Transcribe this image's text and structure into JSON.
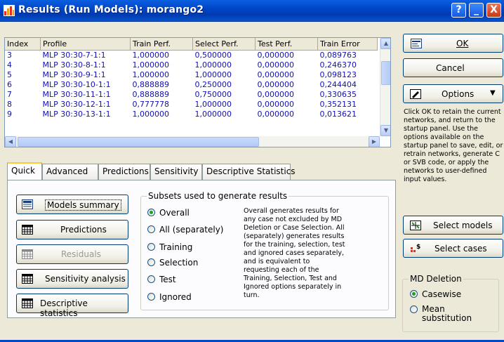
{
  "window": {
    "title": "Results (Run Models): morango2",
    "help_label": "?",
    "min_label": "_",
    "close_label": "X"
  },
  "table": {
    "columns": [
      "Index",
      "Profile",
      "Train Perf.",
      "Select Perf.",
      "Test Perf.",
      "Train Error"
    ],
    "rows": [
      [
        "3",
        "MLP 30:30-7-1:1",
        "1,000000",
        "0,500000",
        "0,000000",
        "0,089763"
      ],
      [
        "4",
        "MLP 30:30-8-1:1",
        "1,000000",
        "1,000000",
        "0,000000",
        "0,246370"
      ],
      [
        "5",
        "MLP 30:30-9-1:1",
        "1,000000",
        "1,000000",
        "0,000000",
        "0,098123"
      ],
      [
        "6",
        "MLP 30:30-10-1:1",
        "0,888889",
        "0,250000",
        "0,000000",
        "0,244404"
      ],
      [
        "7",
        "MLP 30:30-11-1:1",
        "0,888889",
        "0,750000",
        "0,000000",
        "0,330635"
      ],
      [
        "8",
        "MLP 30:30-12-1:1",
        "0,777778",
        "1,000000",
        "0,000000",
        "0,352131"
      ],
      [
        "9",
        "MLP 30:30-13-1:1",
        "1,000000",
        "1,000000",
        "0,000000",
        "0,013621"
      ]
    ]
  },
  "buttons": {
    "ok": "OK",
    "cancel": "Cancel",
    "options": "Options",
    "select_models": "Select models",
    "select_cases": "Select cases"
  },
  "help_text": "Click OK to retain the current networks, and return to the startup panel. Use the options available on the startup panel to save, edit, or retrain networks, generate C or SVB code, or apply the networks to user-defined input values.",
  "md_deletion": {
    "title": "MD Deletion",
    "casewise": "Casewise",
    "mean": "Mean substitution",
    "selected": "casewise"
  },
  "tabs": [
    "Quick",
    "Advanced",
    "Predictions",
    "Sensitivity",
    "Descriptive Statistics"
  ],
  "active_tab": "Quick",
  "quick": {
    "buttons": [
      "Models summary",
      "Predictions",
      "Residuals",
      "Sensitivity analysis",
      "Descriptive statistics"
    ],
    "subsets_title": "Subsets used to generate results",
    "subsets": [
      "Overall",
      "All (separately)",
      "Training",
      "Selection",
      "Test",
      "Ignored"
    ],
    "selected_subset": "Overall",
    "description": "Overall generates results for any case not excluded by MD Deletion or Case Selection. All (separately) generates results for the training, selection, test and ignored cases separately, and is equivalent to requesting each of the Training, Selection, Test and Ignored options separately in turn."
  },
  "icons": [
    "results-app-icon",
    "ok-icon",
    "options-icon",
    "select-models-icon",
    "select-cases-icon",
    "summary-icon",
    "grid-icon"
  ],
  "colors": {
    "title_bar": "#0046c8",
    "table_text": "#1010b8",
    "close_button": "#c63a16"
  }
}
